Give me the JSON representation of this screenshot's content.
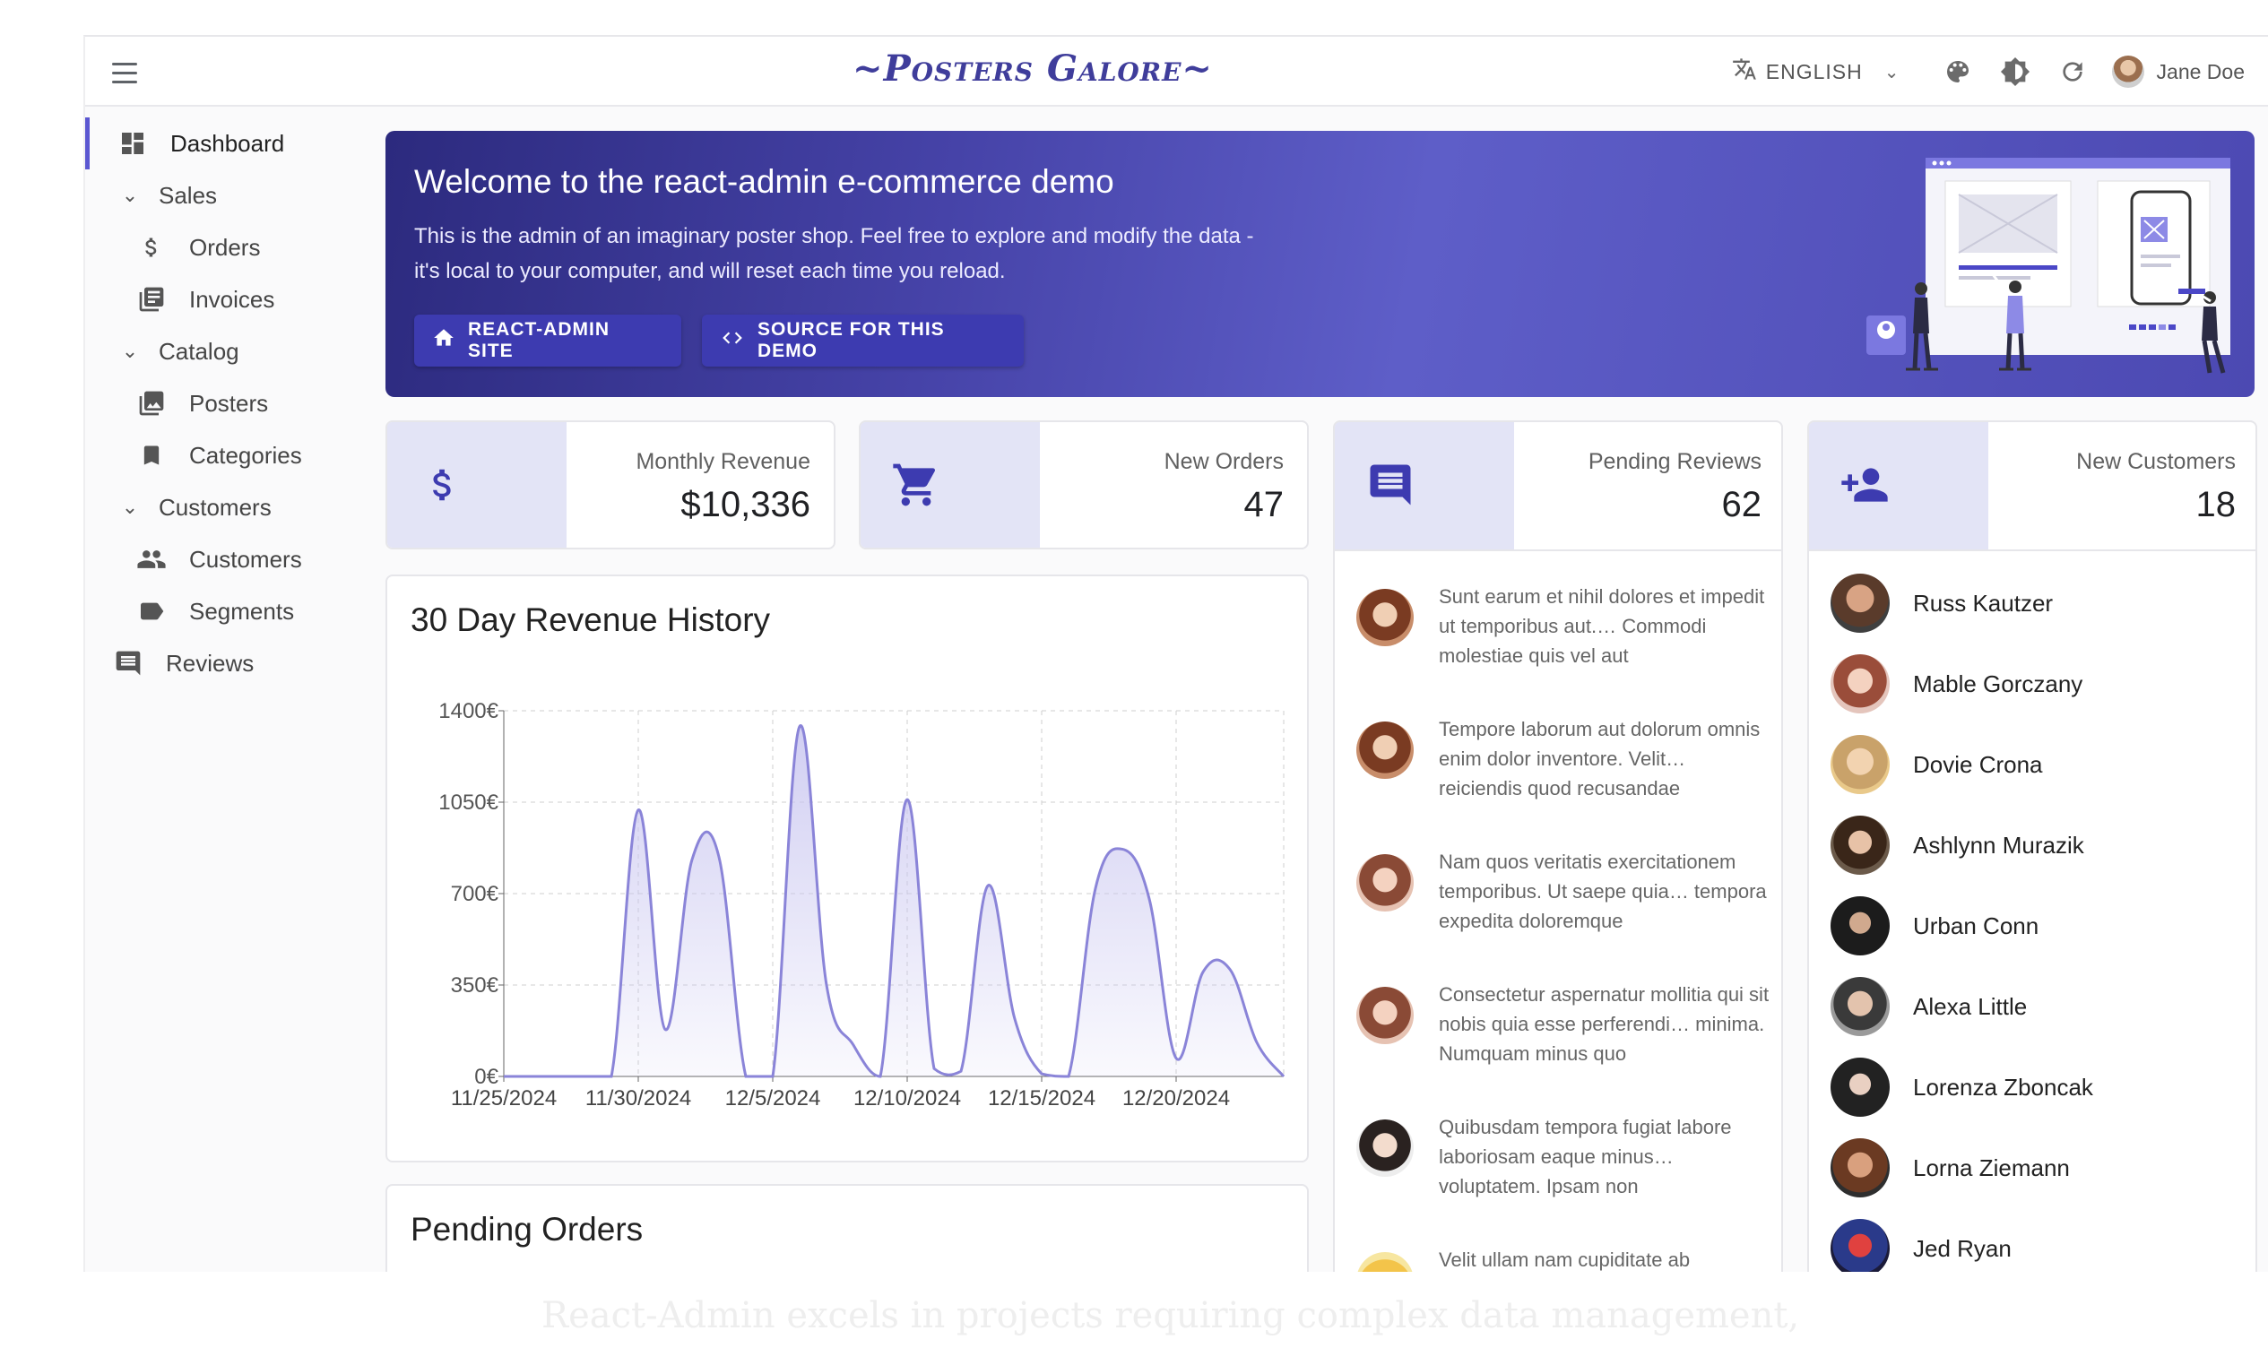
{
  "app_title": "~Posters Galore~",
  "appbar": {
    "language": "ENGLISH",
    "user_name": "Jane Doe"
  },
  "sidebar": {
    "items": [
      {
        "label": "Dashboard",
        "icon": "dashboard-icon",
        "active": true
      },
      {
        "label": "Sales",
        "icon": "chevron-down-icon",
        "group": true
      },
      {
        "label": "Orders",
        "icon": "dollar-icon"
      },
      {
        "label": "Invoices",
        "icon": "invoices-icon"
      },
      {
        "label": "Catalog",
        "icon": "chevron-down-icon",
        "group": true
      },
      {
        "label": "Posters",
        "icon": "image-icon"
      },
      {
        "label": "Categories",
        "icon": "bookmark-icon"
      },
      {
        "label": "Customers",
        "icon": "chevron-down-icon",
        "group": true
      },
      {
        "label": "Customers",
        "icon": "people-icon"
      },
      {
        "label": "Segments",
        "icon": "label-icon"
      },
      {
        "label": "Reviews",
        "icon": "comment-icon"
      }
    ]
  },
  "welcome": {
    "title": "Welcome to the react-admin e-commerce demo",
    "text_line1": "This is the admin of an imaginary poster shop. Feel free to explore and modify the data -",
    "text_line2": "it's local to your computer, and will reset each time you reload.",
    "button_site": "REACT-ADMIN SITE",
    "button_source": "SOURCE FOR THIS DEMO"
  },
  "stats": {
    "monthly_revenue": {
      "label": "Monthly Revenue",
      "value": "$10,336"
    },
    "new_orders": {
      "label": "New Orders",
      "value": "47"
    },
    "pending_reviews": {
      "label": "Pending Reviews",
      "value": "62"
    },
    "new_customers": {
      "label": "New Customers",
      "value": "18"
    }
  },
  "reviews": [
    "Sunt earum et nihil dolores et impedit ut temporibus aut.… Commodi molestiae quis vel aut",
    "Tempore laborum aut dolorum omnis enim dolor inventore. Velit… reiciendis quod recusandae",
    "Nam quos veritatis exercitationem temporibus. Ut saepe quia… tempora expedita doloremque",
    "Consectetur aspernatur mollitia qui sit nobis quia esse perferendi… minima. Numquam minus quo",
    "Quibusdam tempora fugiat labore laboriosam eaque minus… voluptatem. Ipsam non",
    "Velit ullam nam cupiditate ab"
  ],
  "customers": [
    "Russ Kautzer",
    "Mable Gorczany",
    "Dovie Crona",
    "Ashlynn Murazik",
    "Urban Conn",
    "Alexa Little",
    "Lorenza Zboncak",
    "Lorna Ziemann",
    "Jed Ryan"
  ],
  "revenue_card_title": "30 Day Revenue History",
  "orders_card_title": "Pending Orders",
  "footer_text": "React-Admin excels in projects requiring complex data management,",
  "colors": {
    "accent": "#5b57d1",
    "chart_line": "#8a84d8",
    "chart_fill": "#c9c6f0"
  },
  "chart_data": {
    "type": "area",
    "title": "30 Day Revenue History",
    "xlabel": "",
    "ylabel": "",
    "ylim": [
      0,
      1400
    ],
    "y_ticks": [
      "0€",
      "350€",
      "700€",
      "1050€",
      "1400€"
    ],
    "x_ticks": [
      "11/25/2024",
      "11/30/2024",
      "12/5/2024",
      "12/10/2024",
      "12/15/2024",
      "12/20/2024"
    ],
    "x_start": "2024-11-25",
    "x_end": "2024-12-24",
    "grid": true,
    "series": [
      {
        "x": [
          "2024-11-25",
          "2024-11-26",
          "2024-11-27",
          "2024-11-28",
          "2024-11-29",
          "2024-11-30",
          "2024-12-01",
          "2024-12-02",
          "2024-12-03",
          "2024-12-04",
          "2024-12-05",
          "2024-12-06",
          "2024-12-07",
          "2024-12-08",
          "2024-12-09",
          "2024-12-10",
          "2024-12-11",
          "2024-12-12",
          "2024-12-13",
          "2024-12-14",
          "2024-12-15",
          "2024-12-16",
          "2024-12-17",
          "2024-12-18",
          "2024-12-19",
          "2024-12-20",
          "2024-12-21",
          "2024-12-22",
          "2024-12-23",
          "2024-12-24"
        ],
        "values": [
          0,
          0,
          0,
          0,
          0,
          1020,
          180,
          830,
          840,
          0,
          0,
          1340,
          350,
          120,
          0,
          1060,
          30,
          20,
          730,
          220,
          10,
          0,
          720,
          870,
          680,
          70,
          400,
          410,
          130,
          0
        ]
      }
    ]
  }
}
